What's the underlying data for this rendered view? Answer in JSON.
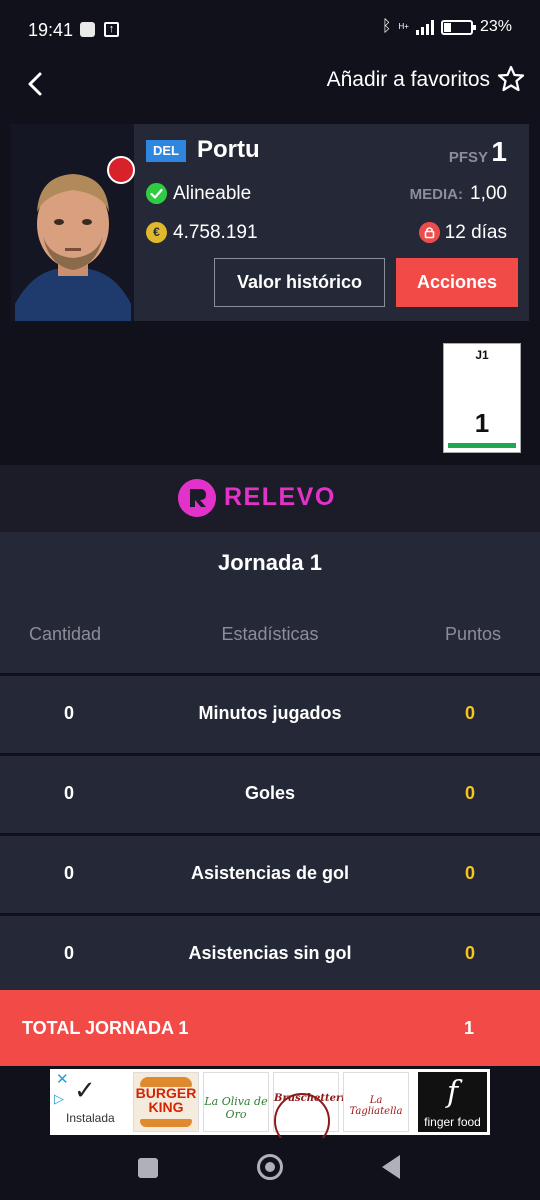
{
  "status_bar": {
    "time": "19:41",
    "network": "H+",
    "battery": "23%"
  },
  "header": {
    "favorite_label": "Añadir a favoritos"
  },
  "player": {
    "position": "DEL",
    "name": "Portu",
    "pfsy_label": "PFSY",
    "pfsy_value": "1",
    "status": "Alineable",
    "media_label": "MEDIA:",
    "media_value": "1,00",
    "market_value": "4.758.191",
    "coin_symbol": "€",
    "lock_days": "12 días",
    "button_history": "Valor histórico",
    "button_actions": "Acciones"
  },
  "rounds": [
    {
      "label": "J1",
      "points": "1"
    }
  ],
  "sponsor": {
    "name": "RELEVO"
  },
  "stats": {
    "title": "Jornada 1",
    "columns": {
      "quantity": "Cantidad",
      "stat": "Estadísticas",
      "points": "Puntos"
    },
    "rows": [
      {
        "quantity": "0",
        "name": "Minutos jugados",
        "points": "0"
      },
      {
        "quantity": "0",
        "name": "Goles",
        "points": "0"
      },
      {
        "quantity": "0",
        "name": "Asistencias de gol",
        "points": "0"
      },
      {
        "quantity": "0",
        "name": "Asistencias sin gol",
        "points": "0"
      }
    ],
    "total_label": "TOTAL JORNADA 1",
    "total_value": "1"
  },
  "ad": {
    "installed_label": "Instalada",
    "brands": [
      "BURGER KING",
      "La Oliva de Oro",
      "Bruschetteria",
      "La Tagliatella",
      "finger food"
    ]
  },
  "colors": {
    "accent": "#f24a46",
    "background": "#11111b",
    "card": "#252836",
    "points": "#f5c518",
    "relevo": "#e332c9"
  }
}
